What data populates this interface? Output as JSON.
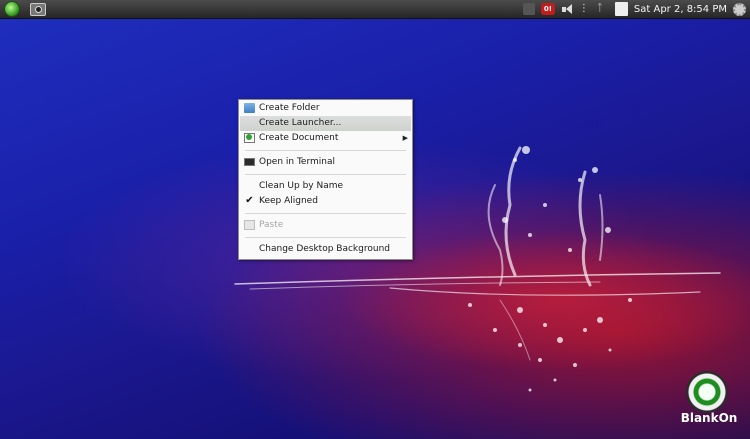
{
  "panel": {
    "clock": "Sat Apr  2,  8:54 PM",
    "update_badge": "0!"
  },
  "context_menu": {
    "items": [
      {
        "label": "Create Folder",
        "icon": "folder-icon"
      },
      {
        "label": "Create Launcher...",
        "icon": ""
      },
      {
        "label": "Create Document",
        "icon": "document-icon",
        "submenu": true
      },
      {
        "label": "Open in Terminal",
        "icon": "terminal-icon"
      },
      {
        "label": "Clean Up by Name",
        "icon": ""
      },
      {
        "label": "Keep Aligned",
        "icon": "check-icon",
        "checked": true
      },
      {
        "label": "Paste",
        "icon": "paste-icon",
        "disabled": true
      },
      {
        "label": "Change Desktop Background",
        "icon": ""
      }
    ],
    "submenu_arrow": "▶",
    "check_mark": "✔"
  },
  "logo": {
    "text": "BlankOn"
  },
  "colors": {
    "panel": "#333333",
    "menu_bg": "#fafafa",
    "menu_highlight": "#d5d8d5",
    "desktop_blue": "#1b1890",
    "desktop_red": "#aa1428"
  }
}
